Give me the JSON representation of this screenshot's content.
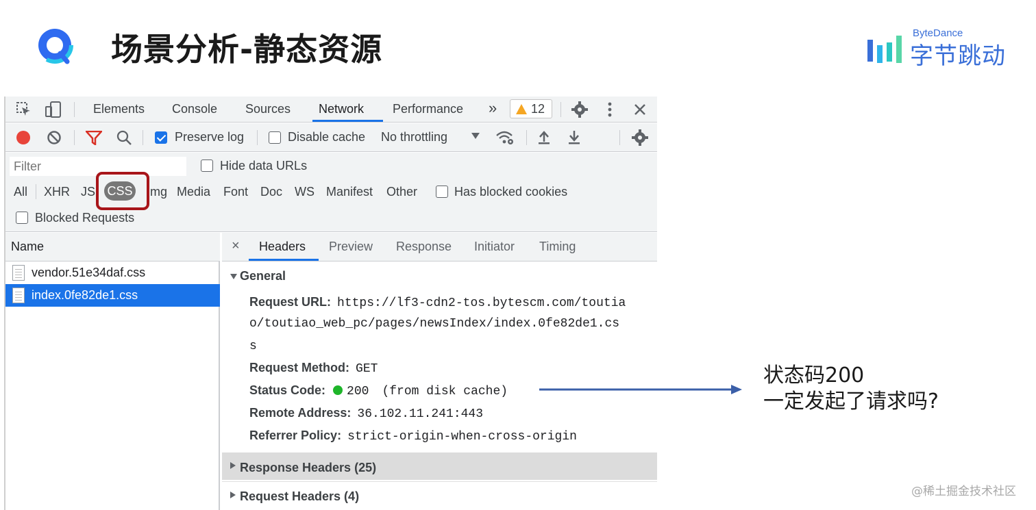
{
  "slide": {
    "title": "场景分析-静态资源",
    "brand_small": "ByteDance",
    "brand_big": "字节跳动"
  },
  "devtools": {
    "tabs": [
      "Elements",
      "Console",
      "Sources",
      "Network",
      "Performance"
    ],
    "active_tab": "Network",
    "more_tabs": "»",
    "warning_count": "12",
    "toolbar": {
      "preserve_log": "Preserve log",
      "preserve_log_checked": true,
      "disable_cache": "Disable cache",
      "throttling": "No throttling"
    },
    "filter": {
      "placeholder": "Filter",
      "hide_data_urls": "Hide data URLs",
      "types": [
        "All",
        "XHR",
        "JS",
        "CSS",
        "Img",
        "Media",
        "Font",
        "Doc",
        "WS",
        "Manifest",
        "Other"
      ],
      "active_type": "CSS",
      "has_blocked_cookies": "Has blocked cookies",
      "blocked_requests": "Blocked Requests"
    },
    "name_header": "Name",
    "requests": [
      {
        "name": "vendor.51e34daf.css",
        "selected": false
      },
      {
        "name": "index.0fe82de1.css",
        "selected": true
      }
    ],
    "detail_tabs": [
      "Headers",
      "Preview",
      "Response",
      "Initiator",
      "Timing"
    ],
    "active_detail_tab": "Headers",
    "general": {
      "title": "General",
      "request_url_label": "Request URL:",
      "request_url_lines": [
        "https://lf3-cdn2-tos.bytescm.com/toutia",
        "o/toutiao_web_pc/pages/newsIndex/index.0fe82de1.cs",
        "s"
      ],
      "request_method_label": "Request Method:",
      "request_method": "GET",
      "status_code_label": "Status Code:",
      "status_code": "200",
      "status_note": "(from disk cache)",
      "remote_address_label": "Remote Address:",
      "remote_address": "36.102.11.241:443",
      "referrer_policy_label": "Referrer Policy:",
      "referrer_policy": "strict-origin-when-cross-origin"
    },
    "response_headers": "Response Headers (25)",
    "request_headers": "Request Headers (4)"
  },
  "annotation": {
    "line1": "状态码200",
    "line2": "一定发起了请求吗?"
  },
  "watermark": "@稀土掘金技术社区",
  "colors": {
    "accent": "#1a73e8",
    "highlight_box": "#a8151a",
    "arrow": "#3b5fa8",
    "brand": "#3a6fd8"
  }
}
